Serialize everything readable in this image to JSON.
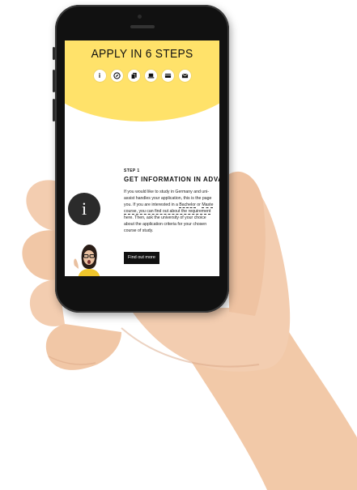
{
  "screen": {
    "title": "APPLY IN 6 STEPS",
    "step_icons": [
      {
        "name": "info-icon",
        "glyph": "i"
      },
      {
        "name": "compass-icon"
      },
      {
        "name": "documents-icon"
      },
      {
        "name": "laptop-icon"
      },
      {
        "name": "card-icon"
      },
      {
        "name": "mail-icon"
      }
    ],
    "step_label": "STEP 1",
    "step_title": "GET INFORMATION IN ADVANC",
    "body": {
      "line1": "If you would like to study in Germany and uni-",
      "line2": "assist handles your application, this is the page",
      "line3": "you. If you are interested in a ",
      "bachelor": "Bachelor",
      "or": " or ",
      "master": "Maste",
      "line4_link": "course, you can find out about the requirement",
      "line5": "here. Then, ask the university of your choice",
      "line6": "about the application criteria for your chosen",
      "line7": "course of study."
    },
    "cta_label": "Find out more",
    "info_glyph": "i"
  },
  "colors": {
    "accent_yellow": "#ffe26a",
    "button_dark": "#111111"
  }
}
